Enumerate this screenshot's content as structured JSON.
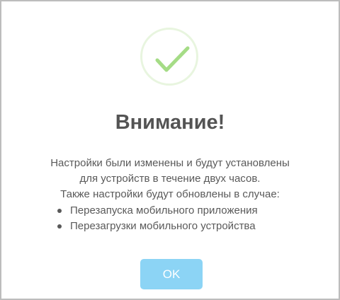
{
  "dialog": {
    "icon": "success-check-icon",
    "title": "Внимание!",
    "message_lines": [
      "Настройки были изменены и будут установлены",
      "для устройств в течение двух часов.",
      "Также настройки будут обновлены в случае:"
    ],
    "bullets": [
      "Перезапуска мобильного приложения",
      "Перезагрузки мобильного устройства"
    ],
    "ok_label": "OK"
  },
  "colors": {
    "check": "#a5dc86",
    "circle_border": "#e8f5df",
    "button": "#8cd4f5",
    "title": "#545454",
    "text": "#595959"
  }
}
